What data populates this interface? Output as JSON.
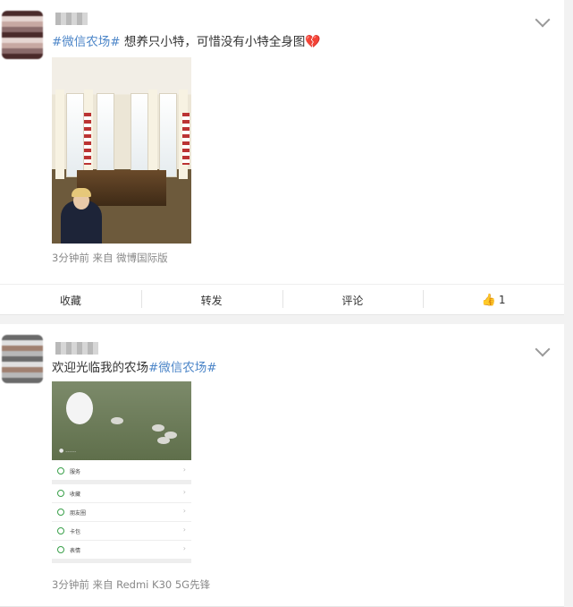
{
  "posts": [
    {
      "text_tag": "#微信农场#",
      "text_body": " 想养只小特，可惜没有小特全身图",
      "heart": "💔",
      "meta": "3分钟前  来自 微博国际版",
      "actions": {
        "collect": "收藏",
        "repost": "转发",
        "comment": "评论",
        "like_count": "1"
      }
    },
    {
      "text_body": "欢迎光临我的农场",
      "text_tag": "#微信农场#",
      "meta": "3分钟前  来自 Redmi K30 5G先锋",
      "screenshot_rows": [
        "服务",
        "收藏",
        "朋友圈",
        "卡包",
        "表情"
      ]
    }
  ]
}
